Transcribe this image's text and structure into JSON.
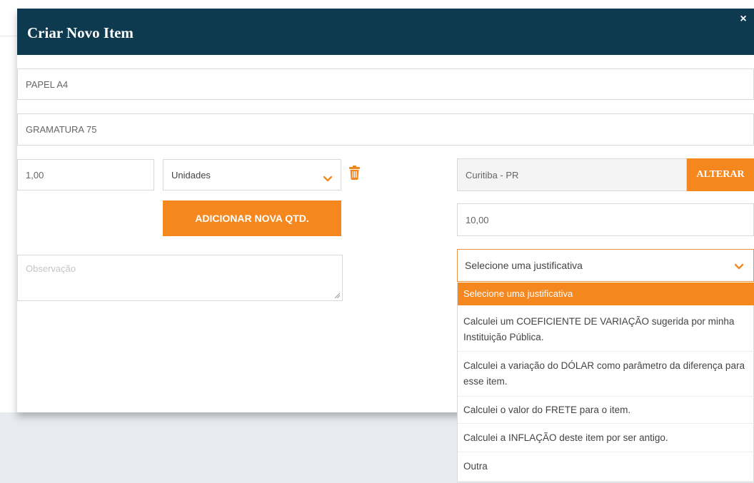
{
  "modal": {
    "title": "Criar Novo Item",
    "close_glyph": "×"
  },
  "form": {
    "item_name": "PAPEL A4",
    "item_description": "GRAMATURA 75",
    "quantity": "1,00",
    "unit": "Unidades",
    "add_qty_label": "ADICIONAR NOVA QTD.",
    "observation_placeholder": "Observação",
    "location": "Curitiba - PR",
    "change_label": "ALTERAR",
    "value": "10,00",
    "justification_selected": "Selecione uma justificativa"
  },
  "justification_options": [
    "Selecione uma justificativa",
    "Calculei um COEFICIENTE DE VARIAÇÃO sugerida por minha Instituição Pública.",
    "Calculei a variação do DÓLAR como parâmetro da diferença para esse item.",
    "Calculei o valor do FRETE para o item.",
    "Calculei a INFLAÇÃO deste item por ser antigo.",
    "Outra"
  ],
  "colors": {
    "header": "#0e3a4f",
    "accent": "#f5871f"
  },
  "icons": [
    "close-icon",
    "chevron-down-icon",
    "trash-icon"
  ]
}
